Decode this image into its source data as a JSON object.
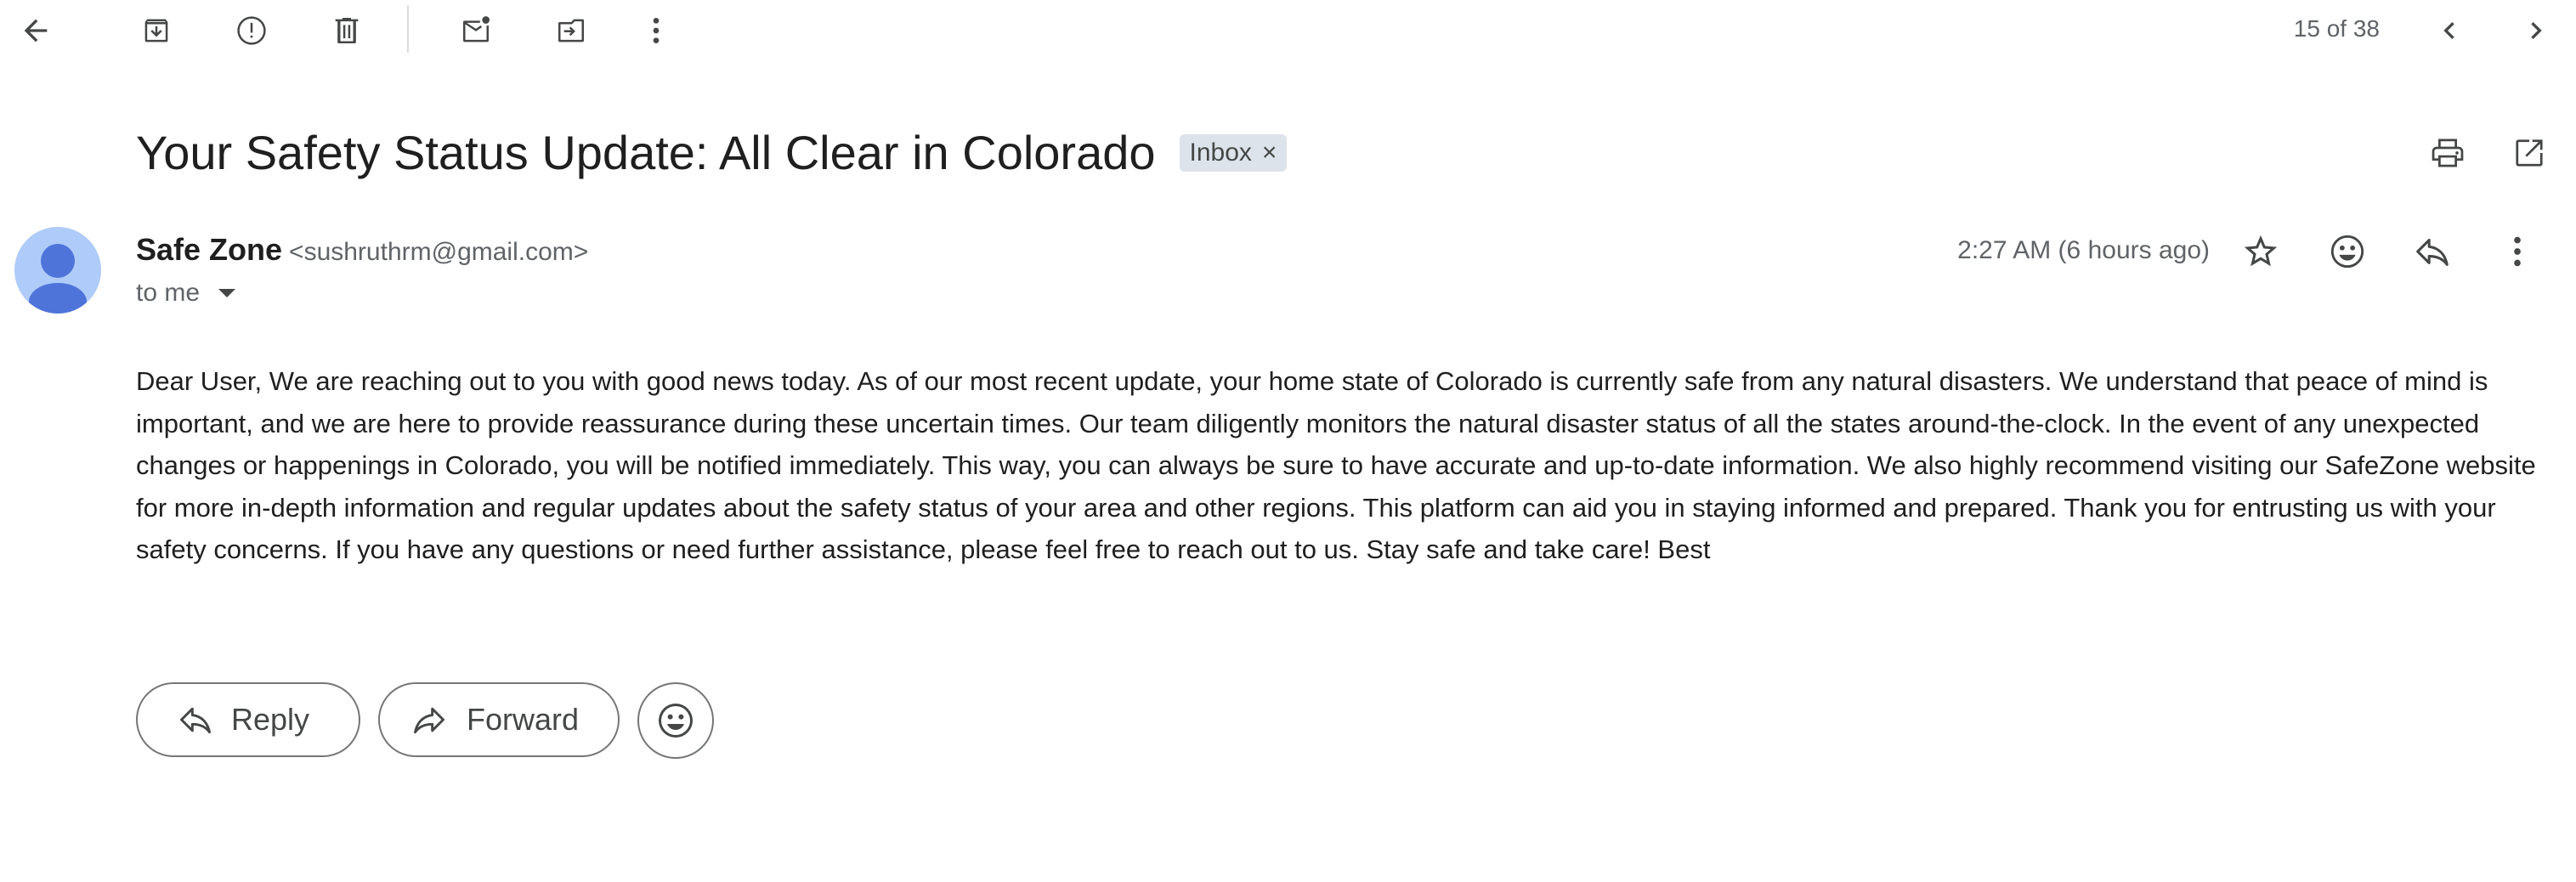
{
  "toolbar": {
    "icons": [
      "back-arrow-icon",
      "archive-icon",
      "report-spam-icon",
      "delete-icon",
      "mark-unread-icon",
      "move-to-icon",
      "more-vert-icon"
    ],
    "pager": "15 of 38"
  },
  "email": {
    "subject": "Your Safety Status Update: All Clear in Colorado",
    "label": "Inbox",
    "label_remove": "×",
    "sender_name": "Safe Zone",
    "sender_email": "<sushruthrm@gmail.com>",
    "recipient": "to me",
    "timestamp": "2:27 AM (6 hours ago)",
    "body": "Dear User, We are reaching out to you with good news today. As of our most recent update, your home state of Colorado is currently safe from any natural disasters. We understand that peace of mind is important, and we are here to provide reassurance during these uncertain times. Our team diligently monitors the natural disaster status of all the states around-the-clock. In the event of any unexpected changes or happenings in Colorado, you will be notified immediately. This way, you can always be sure to have accurate and up-to-date information. We also highly recommend visiting our SafeZone website for more in-depth information and regular updates about the safety status of your area and other regions. This platform can aid you in staying informed and prepared. Thank you for entrusting us with your safety concerns. If you have any questions or need further assistance, please feel free to reach out to us. Stay safe and take care! Best"
  },
  "actions": {
    "reply_label": "Reply",
    "forward_label": "Forward"
  },
  "colors": {
    "avatar_bg": "#aecbfa",
    "avatar_fg": "#4f74d9",
    "label_chip_bg": "#dde3ea",
    "icon": "#444746"
  }
}
